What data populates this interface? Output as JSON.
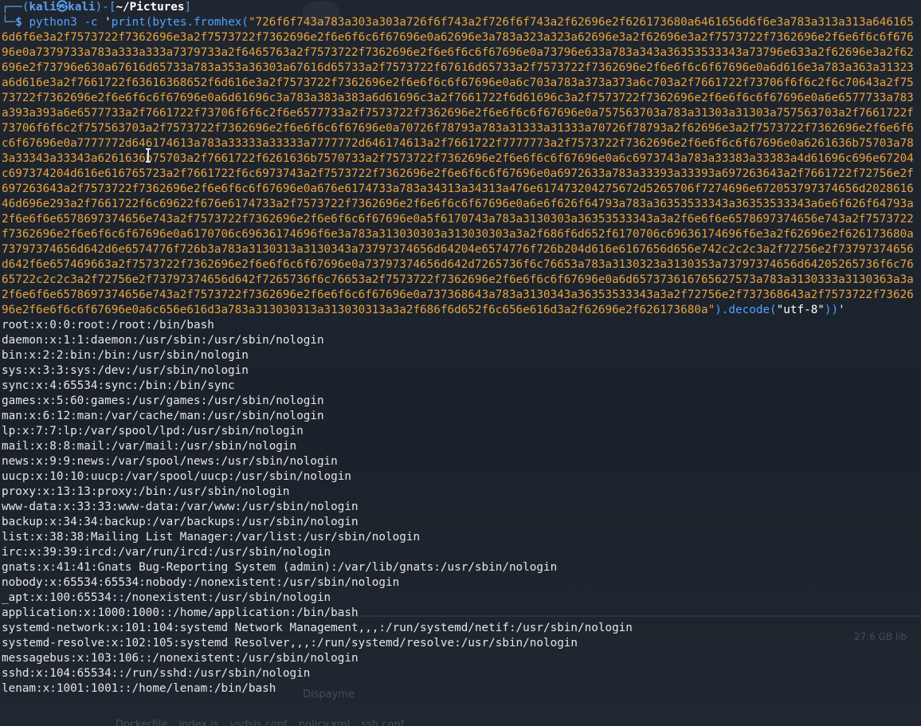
{
  "prompt": {
    "box_top": "┌──",
    "open_paren": "(",
    "user": "kali",
    "at": "㉿",
    "host": "kali",
    "close_paren": ")",
    "dash": "-",
    "open_bracket": "[",
    "cwd": "~/Pictures",
    "close_bracket": "]",
    "box_bottom": "└─",
    "dollar": "$"
  },
  "command": {
    "program": "python3",
    "args": "-c",
    "q1": "'",
    "code_a": "print(bytes.fromhex(",
    "dq1": "\"",
    "hex": "726f6f743a783a303a303a726f6f743a2f726f6f743a2f62696e2f626173680a6461656d6f6e3a783a313a313a6461656d6f6e3a2f7573722f7362696e3a2f7573722f7362696e2f6e6f6c6f67696e0a62696e3a783a323a323a62696e3a2f62696e3a2f7573722f7362696e2f6e6f6c6f67696e0a7379733a783a333a333a7379733a2f6465763a2f7573722f7362696e2f6e6f6c6f67696e0a73796e633a783a343a36353533343a73796e633a2f62696e3a2f62696e2f73796e630a67616d65733a783a353a36303a67616d65733a2f7573722f67616d65733a2f7573722f7362696e2f6e6f6c6f67696e0a6d616e3a783a363a31323a6d616e3a2f7661722f63616368652f6d616e3a2f7573722f7362696e2f6e6f6c6f67696e0a6c703a783a373a373a6c703a2f7661722f73706f6f6c2f6c70643a2f7573722f7362696e2f6e6f6c6f67696e0a6d61696c3a783a383a383a6d61696c3a2f7661722f6d61696c3a2f7573722f7362696e2f6e6f6c6f67696e0a6e6577733a783a393a393a6e6577733a2f7661722f73706f6f6c2f6e6577733a2f7573722f7362696e2f6e6f6c6f67696e0a757563703a783a31303a31303a757563703a2f7661722f73706f6f6c2f757563703a2f7573722f7362696e2f6e6f6c6f67696e0a70726f78793a783a31333a31333a70726f78793a2f62696e3a2f7573722f7362696e2f6e6f6c6f67696e0a7777772d646174613a783a33333a33333a7777772d646174613a2f7661722f7777773a2f7573722f7362696e2f6e6f6c6f67696e0a6261636b75703a783a33343a33343a6261636b75703a2f7661722f6261636b7570733a2f7573722f7362696e2f6e6f6c6f67696e0a6c6973743a783a33383a33383a4d61696c696e67204c697374204d616e616765723a2f7661722f6c6973743a2f7573722f7362696e2f6e6f6c6f67696e0a6972633a783a33393a33393a697263643a2f7661722f72756e2f697263643a2f7573722f7362696e2f6e6f6c6f67696e0a676e6174733a783a34313a34313a476e617473204275672d5265706f7274696e672053797374656d202861646d696e293a2f7661722f6c69622f676e6174733a2f7573722f7362696e2f6e6f6c6f67696e0a6e6f626f64793a783a36353533343a36353533343a6e6f626f64793a2f6e6f6e6578697374656e743a2f7573722f7362696e2f6e6f6c6f67696e0a5f6170743a783a3130303a36353533343a3a2f6e6f6e6578697374656e743a2f7573722f7362696e2f6e6f6c6f67696e0a6170706c69636174696f6e3a783a313030303a313030303a3a2f686f6d652f6170706c69636174696f6e3a2f62696e2f626173680a73797374656d642d6e6574776f726b3a783a3130313a3130343a73797374656d64204e6574776f726b204d616e6167656d656e742c2c2c3a2f72756e2f73797374656d642f6e657469663a2f7573722f7362696e2f6e6f6c6f67696e0a73797374656d642d7265736f6c76653a783a3130323a3130353a73797374656d64205265736f6c7665722c2c2c3a2f72756e2f73797374656d642f7265736f6c76653a2f7573722f7362696e2f6e6f6c6f67696e0a6d657373616765627573a783a3130333a3130363a3a2f6e6f6e6578697374656e743a2f7573722f7362696e2f6e6f6c6f67696e0a737368643a783a3130343a36353533343a3a2f72756e2f737368643a2f7573722f7362696e2f6e6f6c6f67696e0a6c656e616d3a783a313030313a313030313a3a2f686f6d652f6c656e616d3a2f62696e2f626173680a",
    "dq2": "\"",
    "code_b": ").decode(",
    "enc": "\"utf-8\"",
    "code_c": "))",
    "q2": "'"
  },
  "output": [
    "root:x:0:0:root:/root:/bin/bash",
    "daemon:x:1:1:daemon:/usr/sbin:/usr/sbin/nologin",
    "bin:x:2:2:bin:/bin:/usr/sbin/nologin",
    "sys:x:3:3:sys:/dev:/usr/sbin/nologin",
    "sync:x:4:65534:sync:/bin:/bin/sync",
    "games:x:5:60:games:/usr/games:/usr/sbin/nologin",
    "man:x:6:12:man:/var/cache/man:/usr/sbin/nologin",
    "lp:x:7:7:lp:/var/spool/lpd:/usr/sbin/nologin",
    "mail:x:8:8:mail:/var/mail:/usr/sbin/nologin",
    "news:x:9:9:news:/var/spool/news:/usr/sbin/nologin",
    "uucp:x:10:10:uucp:/var/spool/uucp:/usr/sbin/nologin",
    "proxy:x:13:13:proxy:/bin:/usr/sbin/nologin",
    "www-data:x:33:33:www-data:/var/www:/usr/sbin/nologin",
    "backup:x:34:34:backup:/var/backups:/usr/sbin/nologin",
    "list:x:38:38:Mailing List Manager:/var/list:/usr/sbin/nologin",
    "irc:x:39:39:ircd:/var/run/ircd:/usr/sbin/nologin",
    "gnats:x:41:41:Gnats Bug-Reporting System (admin):/var/lib/gnats:/usr/sbin/nologin",
    "nobody:x:65534:65534:nobody:/nonexistent:/usr/sbin/nologin",
    "_apt:x:100:65534::/nonexistent:/usr/sbin/nologin",
    "application:x:1000:1000::/home/application:/bin/bash",
    "systemd-network:x:101:104:systemd Network Management,,,:/run/systemd/netif:/usr/sbin/nologin",
    "systemd-resolve:x:102:105:systemd Resolver,,,:/run/systemd/resolve:/usr/sbin/nologin",
    "messagebus:x:103:106::/nonexistent:/usr/sbin/nologin",
    "sshd:x:104:65534::/run/sshd:/usr/sbin/nologin",
    "lenam:x:1001:1001::/home/lenam:/bin/bash"
  ],
  "background_window": {
    "size_text": "27.6 GB lib",
    "file_tabs": [
      "Dockerfile",
      "index.js",
      "vsdsis.conf",
      "policy.xml",
      "ssh.conf"
    ],
    "label": "Dispayme"
  },
  "colors": {
    "prompt": "#5aa0f0",
    "command": "#4fa3ff",
    "hex_string": "#e8a33d",
    "output_text": "#e6e6e6",
    "background": "#1b222b"
  }
}
